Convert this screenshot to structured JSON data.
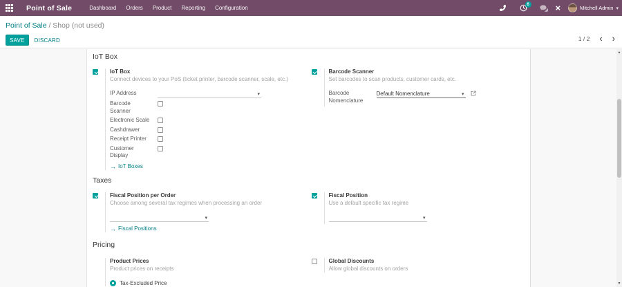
{
  "colors": {
    "navbar": "#714B67",
    "accent": "#00A09D",
    "link": "#017E84"
  },
  "navbar": {
    "brand": "Point of Sale",
    "menus": [
      "Dashboard",
      "Orders",
      "Product",
      "Reporting",
      "Configuration"
    ],
    "activity_badge": "6",
    "user": "Mitchell Admin"
  },
  "icons": {
    "caret_down": "▾",
    "arrow_link": "→",
    "chevron_left": "‹",
    "chevron_right": "›",
    "close": "×",
    "scroll_up": "▲",
    "scroll_down": "▼"
  },
  "control": {
    "breadcrumb_app": "Point of Sale",
    "breadcrumb_rest": " / Shop (not used)",
    "save": "SAVE",
    "discard": "DISCARD",
    "pager": "1 / 2"
  },
  "sections": {
    "iot_title": "IoT Box",
    "taxes_title": "Taxes",
    "pricing_title": "Pricing"
  },
  "settings": {
    "iot": {
      "enabled": true,
      "title": "IoT Box",
      "desc": "Connect devices to your PoS (ticket printer, barcode scanner, scale, etc.)",
      "ip_label": "IP Address",
      "devices": [
        "Barcode Scanner",
        "Electronic Scale",
        "Cashdrawer",
        "Receipt Printer",
        "Customer Display"
      ],
      "devices_checked": [
        false,
        false,
        false,
        false,
        false
      ],
      "link": "IoT Boxes"
    },
    "barcode": {
      "enabled": true,
      "title": "Barcode Scanner",
      "desc": "Set barcodes to scan products, customer cards, etc.",
      "field_label": "Barcode Nomenclature",
      "field_value": "Default Nomenclature"
    },
    "fiscal_order": {
      "enabled": true,
      "title": "Fiscal Position per Order",
      "desc": "Choose among several tax regimes when processing an order",
      "link": "Fiscal Positions"
    },
    "fiscal": {
      "enabled": true,
      "title": "Fiscal Position",
      "desc": "Use a default specific tax regime"
    },
    "product_prices": {
      "title": "Product Prices",
      "desc": "Product prices on receipts",
      "radio": "Tax-Excluded Price",
      "radio_selected": true
    },
    "global_discounts": {
      "enabled": false,
      "title": "Global Discounts",
      "desc": "Allow global discounts on orders"
    }
  }
}
